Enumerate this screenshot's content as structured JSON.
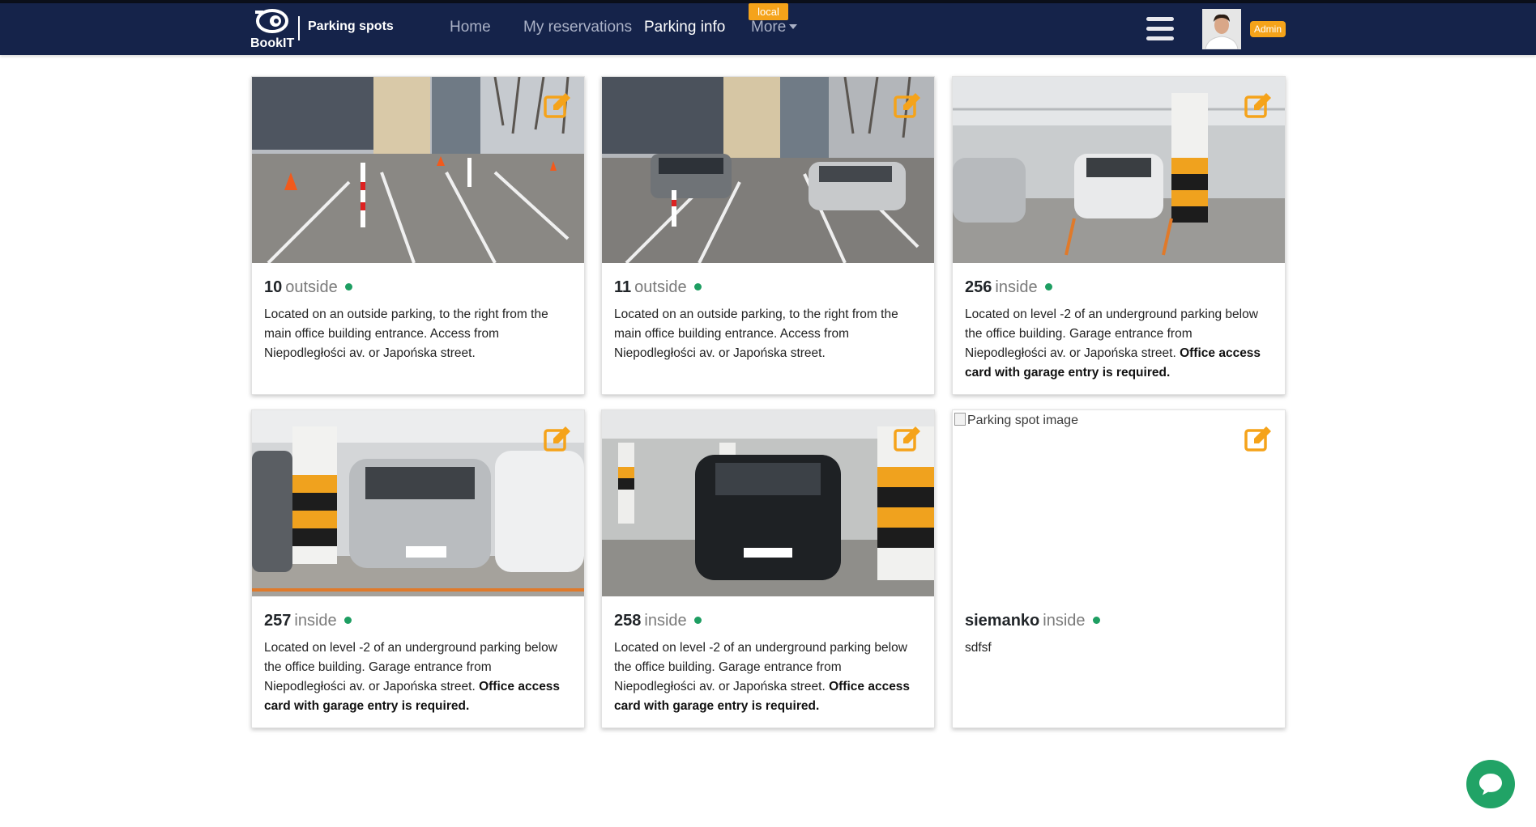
{
  "app": {
    "brand_name": "BookIT",
    "page_name": "Parking spots",
    "env_badge": "local",
    "role_badge": "Admin"
  },
  "nav": {
    "home": "Home",
    "my_reservations": "My reservations",
    "parking_info": "Parking info",
    "more": "More"
  },
  "colors": {
    "navbar": "#15234a",
    "accent": "#f5a31a",
    "status_available": "#1e9e62",
    "chat_button": "#21a366"
  },
  "icons": {
    "logo": "bookit-logo-icon",
    "menu": "hamburger-menu-icon",
    "edit": "edit-pencil-icon",
    "chat": "chat-bubble-icon"
  },
  "spots": [
    {
      "name": "10",
      "type": "outside",
      "description": "Located on an outside parking, to the right from the main office building entrance. Access from Niepodległości av. or Japońska street.",
      "bold_note": "",
      "image": "outdoor parking lot with traffic cones and bollards"
    },
    {
      "name": "11",
      "type": "outside",
      "description": "Located on an outside parking, to the right from the main office building entrance. Access from Niepodległości av. or Japońska street.",
      "bold_note": "",
      "image": "outdoor parking lot with two cars"
    },
    {
      "name": "256",
      "type": "inside",
      "description": "Located on level -2 of an underground parking below the office building. Garage entrance from Niepodległości av. or Japońska street.",
      "bold_note": "Office access card with garage entry is required.",
      "image": "underground garage with white car at spot 256"
    },
    {
      "name": "257",
      "type": "inside",
      "description": "Located on level -2 of an underground parking below the office building. Garage entrance from Niepodległości av. or Japońska street.",
      "bold_note": "Office access card with garage entry is required.",
      "image": "underground garage with silver car"
    },
    {
      "name": "258",
      "type": "inside",
      "description": "Located on level -2 of an underground parking below the office building. Garage entrance from Niepodległości av. or Japońska street.",
      "bold_note": "Office access card with garage entry is required.",
      "image": "underground garage with black car"
    },
    {
      "name": "siemanko",
      "type": "inside",
      "description": "sdfsf",
      "bold_note": "",
      "image_alt": "Parking spot image"
    }
  ]
}
